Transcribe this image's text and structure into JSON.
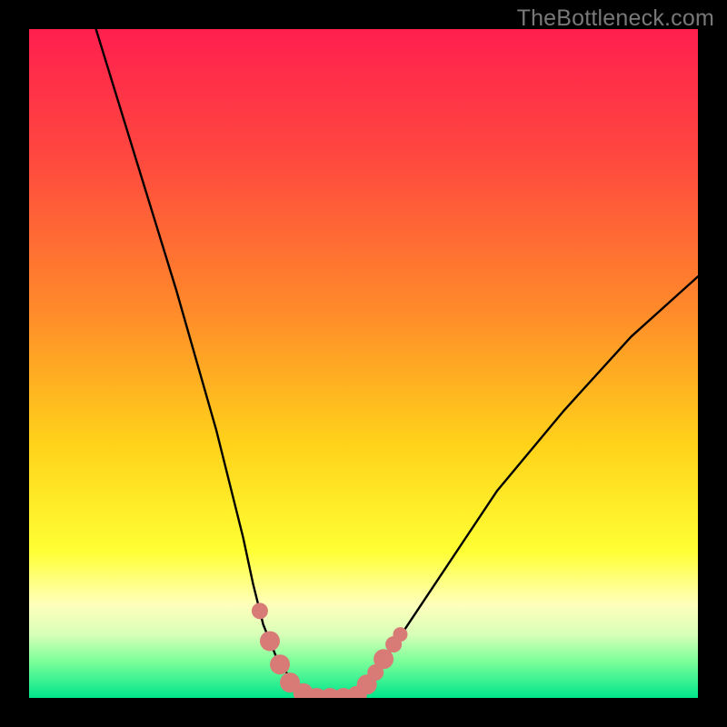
{
  "watermark": "TheBottleneck.com",
  "colors": {
    "frame": "#000000",
    "gradient_stops": [
      {
        "offset": 0.0,
        "color": "#ff1f4f"
      },
      {
        "offset": 0.2,
        "color": "#ff4a3e"
      },
      {
        "offset": 0.42,
        "color": "#ff8a2a"
      },
      {
        "offset": 0.62,
        "color": "#ffd21a"
      },
      {
        "offset": 0.78,
        "color": "#ffff33"
      },
      {
        "offset": 0.86,
        "color": "#ffffbb"
      },
      {
        "offset": 0.905,
        "color": "#d8ffb8"
      },
      {
        "offset": 0.945,
        "color": "#7cff9a"
      },
      {
        "offset": 1.0,
        "color": "#00e58b"
      }
    ],
    "curve": "#000000",
    "markers": "#d87b77"
  },
  "chart_data": {
    "type": "line",
    "title": "",
    "xlabel": "",
    "ylabel": "",
    "xlim": [
      0,
      100
    ],
    "ylim": [
      0,
      100
    ],
    "series": [
      {
        "name": "left-branch",
        "x": [
          10,
          14,
          18,
          22,
          26,
          28,
          30,
          32,
          33.5,
          35,
          37,
          40,
          43
        ],
        "y": [
          100,
          87,
          74,
          61,
          47,
          40,
          32,
          24,
          17,
          11,
          6.0,
          1.5,
          0
        ]
      },
      {
        "name": "floor",
        "x": [
          43,
          46,
          49
        ],
        "y": [
          0,
          0,
          0
        ]
      },
      {
        "name": "right-branch",
        "x": [
          49,
          52,
          56,
          62,
          70,
          80,
          90,
          100
        ],
        "y": [
          0,
          4,
          10,
          19,
          31,
          43,
          54,
          63
        ]
      }
    ],
    "markers": [
      {
        "x": 34.5,
        "y": 13,
        "r": 9
      },
      {
        "x": 36.0,
        "y": 8.5,
        "r": 11
      },
      {
        "x": 37.5,
        "y": 5.0,
        "r": 11
      },
      {
        "x": 39.0,
        "y": 2.3,
        "r": 11
      },
      {
        "x": 41.0,
        "y": 0.7,
        "r": 11
      },
      {
        "x": 43.0,
        "y": 0.0,
        "r": 11
      },
      {
        "x": 45.0,
        "y": 0.0,
        "r": 11
      },
      {
        "x": 47.0,
        "y": 0.0,
        "r": 11
      },
      {
        "x": 49.0,
        "y": 0.3,
        "r": 11
      },
      {
        "x": 50.5,
        "y": 2.0,
        "r": 11
      },
      {
        "x": 51.8,
        "y": 3.8,
        "r": 9
      },
      {
        "x": 53.0,
        "y": 5.8,
        "r": 11
      },
      {
        "x": 54.5,
        "y": 8.0,
        "r": 9
      },
      {
        "x": 55.5,
        "y": 9.5,
        "r": 8
      }
    ]
  }
}
